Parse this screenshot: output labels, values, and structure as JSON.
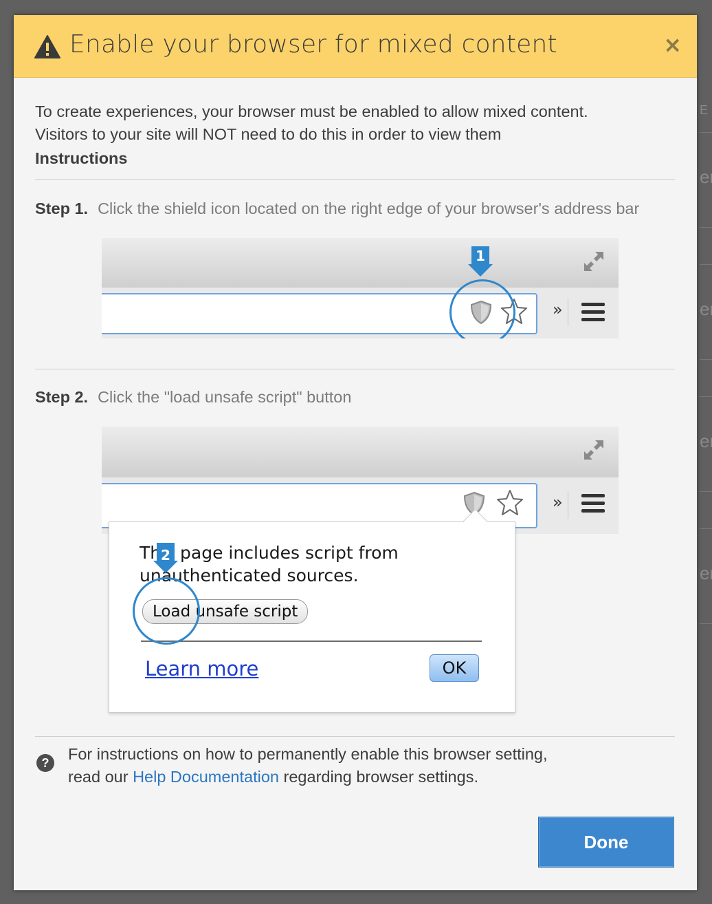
{
  "dialog": {
    "title": "Enable your browser for mixed content",
    "close_label": "×",
    "intro_line1": "To create experiences, your browser must be enabled to allow mixed content.",
    "intro_line2": "Visitors to your site will NOT need to do this in order to view them",
    "instructions_heading": "Instructions"
  },
  "steps": [
    {
      "number": "Step 1.",
      "text": "Click the shield icon located on the right edge of your browser's address bar",
      "callout": "1"
    },
    {
      "number": "Step 2.",
      "text": "Click the \"load unsafe script\" button",
      "callout": "2"
    }
  ],
  "browser_popup": {
    "message_line1": "This page includes script from",
    "message_line2": "unauthenticated sources.",
    "load_button": "Load unsafe script",
    "learn_more": "Learn more",
    "ok_button": "OK",
    "overflow_glyph": "»"
  },
  "help": {
    "line1": "For instructions on how to permanently enable this browser setting,",
    "line2_prefix": "read our ",
    "link": "Help Documentation",
    "line2_suffix": " regarding browser settings."
  },
  "done_button": "Done",
  "colors": {
    "header": "#fbd36a",
    "primary": "#3d87cf",
    "callout": "#2f87cc",
    "link": "#2b77c2"
  },
  "backdrop_fragments": [
    "E",
    "er",
    "er",
    "er",
    "er"
  ]
}
